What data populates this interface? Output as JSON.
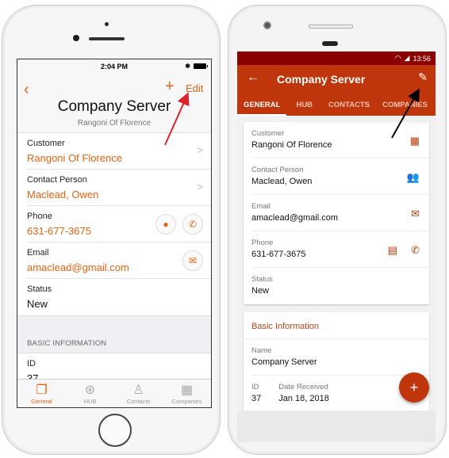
{
  "ios": {
    "status_time": "2:04 PM",
    "bluetooth_icon": "bluetooth-icon",
    "nav": {
      "back_icon": "‹",
      "add_icon": "+",
      "edit_label": "Edit",
      "title": "Company Server",
      "subtitle": "Rangoni Of Florence"
    },
    "fields": [
      {
        "label": "Customer",
        "value": "Rangoni Of Florence"
      },
      {
        "label": "Contact Person",
        "value": "Maclead, Owen"
      },
      {
        "label": "Phone",
        "value": "631-677-3675"
      },
      {
        "label": "Email",
        "value": "amaclead@gmail.com"
      },
      {
        "label": "Status",
        "value": "New"
      }
    ],
    "section_header": "BASIC INFORMATION",
    "basic": [
      {
        "label": "ID",
        "value": "37"
      }
    ],
    "tabs": [
      {
        "label": "General",
        "active": true
      },
      {
        "label": "HUB",
        "active": false
      },
      {
        "label": "Contacts",
        "active": false
      },
      {
        "label": "Companies",
        "active": false
      }
    ],
    "accent_color": "#e8620f"
  },
  "android": {
    "status_time": "13:56",
    "toolbar": {
      "title": "Company Server"
    },
    "tabs": [
      {
        "label": "GENERAL",
        "active": true
      },
      {
        "label": "HUB",
        "active": false
      },
      {
        "label": "CONTACTS",
        "active": false
      },
      {
        "label": "COMPANIES",
        "active": false
      }
    ],
    "fields": [
      {
        "label": "Customer",
        "value": "Rangoni Of Florence"
      },
      {
        "label": "Contact Person",
        "value": "Maclead, Owen"
      },
      {
        "label": "Email",
        "value": "amaclead@gmail.com"
      },
      {
        "label": "Phone",
        "value": "631-677-3675"
      },
      {
        "label": "Status",
        "value": "New"
      }
    ],
    "basic_title": "Basic Information",
    "basic": {
      "name_label": "Name",
      "name_value": "Company Server",
      "id_label": "ID",
      "id_value": "37",
      "date_label": "Date Received",
      "date_value": "Jan 18, 2018"
    },
    "fab_label": "+",
    "primary_color": "#c0360c",
    "status_color": "#8b0000"
  }
}
